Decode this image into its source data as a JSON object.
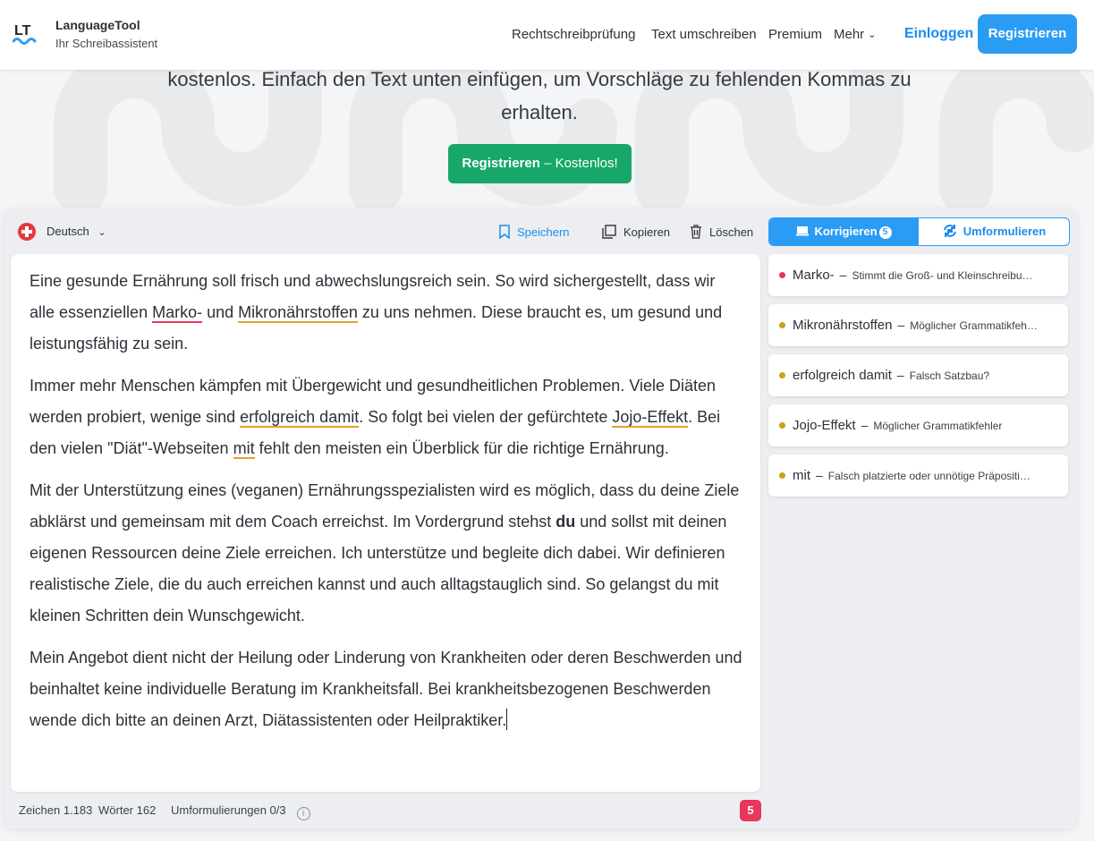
{
  "header": {
    "brand_name": "LanguageTool",
    "brand_sub": "Ihr Schreibassistent",
    "nav": [
      "Rechtschreibprüfung",
      "Text umschreiben",
      "Premium",
      "Mehr"
    ],
    "login": "Einloggen",
    "register": "Registrieren"
  },
  "hero": {
    "text": "kostenlos. Einfach den Text unten einfügen, um Vorschläge zu fehlenden Kommas zu erhalten.",
    "cta_bold": "Registrieren",
    "cta_rest": " – Kostenlos!"
  },
  "toolbar": {
    "language": "Deutsch",
    "save": "Speichern",
    "copy": "Kopieren",
    "delete": "Löschen",
    "tab_correct": "Korrigieren",
    "tab_correct_count": "5",
    "tab_rephrase": "Umformulieren"
  },
  "editor": {
    "p1": {
      "a": "Eine gesunde Ernährung soll frisch und abwechslungsreich sein. So wird sichergestellt, dass wir alle essenziellen ",
      "err1": "Marko-",
      "b": " und ",
      "err2": "Mikronährstoffen",
      "c": " zu uns nehmen. Diese braucht es, um gesund und leistungsfähig zu sein."
    },
    "p2": {
      "a": "Immer mehr Menschen kämpfen mit Übergewicht und gesundheitlichen Problemen. Viele Diäten werden probiert, wenige sind ",
      "err1": "erfolgreich damit",
      "b": ". So folgt bei vielen der gefürchtete ",
      "err2": "Jojo-Effekt",
      "c": ". Bei den vielen \"Diät\"-Webseiten ",
      "err3": "mit",
      "d": " fehlt den meisten ein Überblick für die richtige Ernährung."
    },
    "p3": {
      "a": "Mit der Unterstützung eines (veganen) Ernährungsspezialisten wird es möglich, dass du deine Ziele abklärst und gemeinsam mit dem Coach erreichst. Im Vordergrund stehst ",
      "bold": "du",
      "b": " und sollst mit deinen eigenen Ressourcen deine Ziele erreichen. Ich unterstütze und begleite dich dabei. Wir definieren realistische Ziele, die du auch erreichen kannst und auch alltagstauglich sind. So gelangst du mit kleinen Schritten dein Wunschgewicht."
    },
    "p4": "Mein Angebot dient nicht der Heilung oder Linderung von Krankheiten oder deren Beschwerden und beinhaltet keine individuelle Beratung im Krankheitsfall. Bei krankheitsbezogenen Beschwerden wende dich bitte an deinen Arzt, Diätassistenten oder Heilpraktiker."
  },
  "suggestions": [
    {
      "word": "Marko-",
      "desc": "Stimmt die Groß- und Kleinschreibu…",
      "color": "#e8365d"
    },
    {
      "word": "Mikronährstoffen",
      "desc": "Möglicher Grammatikfeh…",
      "color": "#c9a114"
    },
    {
      "word": "erfolgreich damit",
      "desc": "Falsch Satzbau?",
      "color": "#c9a114"
    },
    {
      "word": "Jojo-Effekt",
      "desc": "Möglicher Grammatikfehler",
      "color": "#c9a114"
    },
    {
      "word": "mit",
      "desc": "Falsch platzierte oder unnötige Präpositi…",
      "color": "#c9a114"
    }
  ],
  "footer": {
    "chars": "Zeichen 1.183",
    "words": "Wörter 162",
    "rephrasings": "Umformulierungen 0/3",
    "error_count": "5"
  },
  "colors": {
    "accent": "#2b9cf3",
    "cta": "#17a768",
    "error_red": "#e8365d",
    "error_yellow": "#e0a32a"
  }
}
